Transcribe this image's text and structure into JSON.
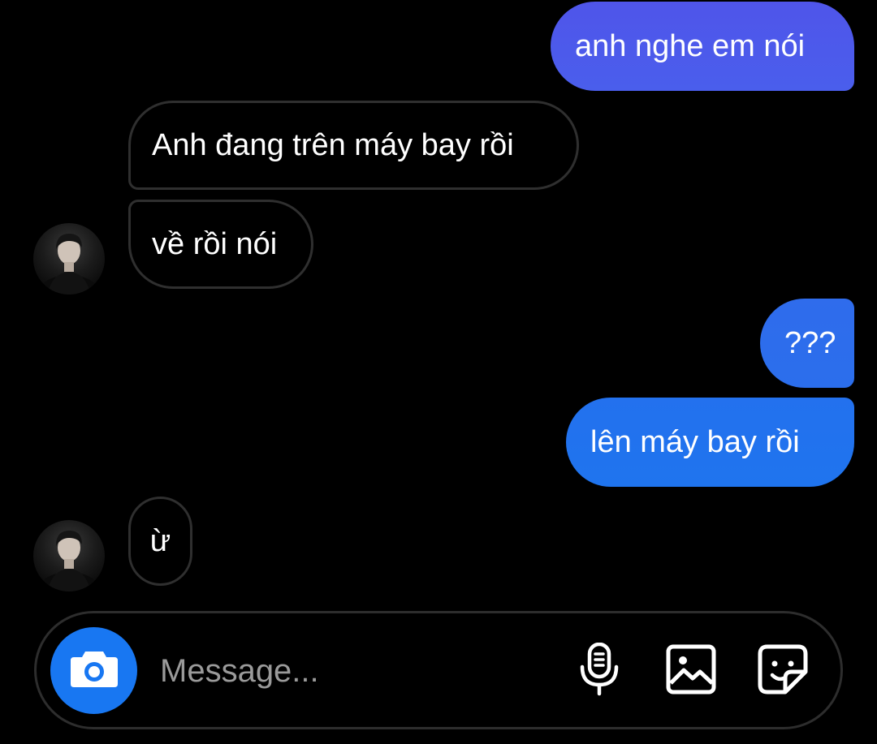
{
  "colors": {
    "sent_gradient_top": "#4f56ea",
    "sent_gradient_bottom": "#1f74ee",
    "received_border": "#2f2f2f",
    "camera_button": "#1877f2",
    "background": "#000000"
  },
  "messages": [
    {
      "direction": "sent",
      "text": "anh nghe em nói"
    },
    {
      "direction": "received",
      "text": "Anh đang trên máy bay rồi"
    },
    {
      "direction": "received",
      "text": "về rồi nói"
    },
    {
      "direction": "sent",
      "text": "???"
    },
    {
      "direction": "sent",
      "text": "lên máy bay rồi"
    },
    {
      "direction": "received",
      "text": "ừ"
    }
  ],
  "composer": {
    "placeholder": "Message...",
    "icons": [
      "camera-icon",
      "microphone-icon",
      "gallery-icon",
      "sticker-icon"
    ]
  }
}
